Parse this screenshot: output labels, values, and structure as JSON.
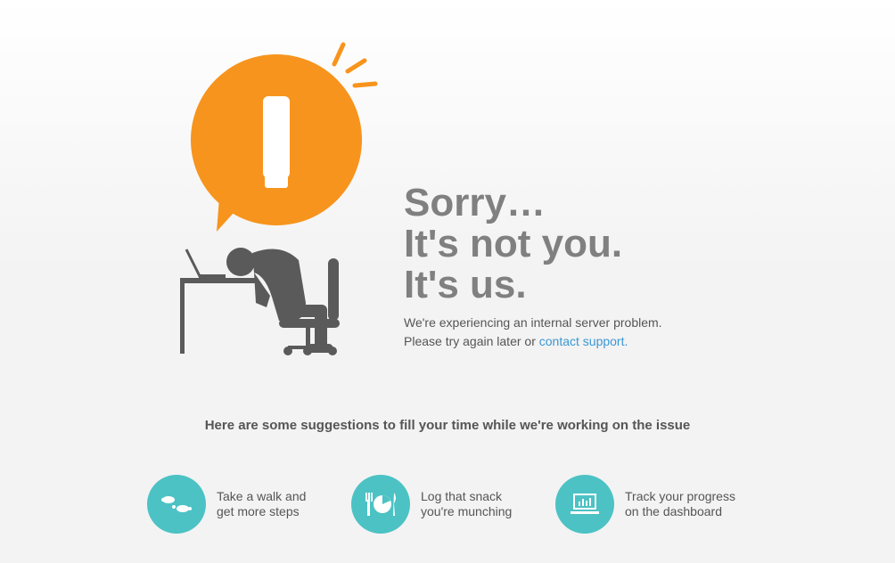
{
  "headline": {
    "line1": "Sorry…",
    "line2": "It's not you.",
    "line3": "It's us."
  },
  "message": {
    "line1": "We're experiencing an internal server problem.",
    "line2_prefix": "Please try again later or ",
    "support_link": "contact support",
    "line2_suffix": "."
  },
  "suggestions_title": "Here are some suggestions to fill your time while we're working on the issue",
  "suggestions": [
    {
      "icon": "footsteps-icon",
      "line1": "Take a walk and",
      "line2": "get more steps"
    },
    {
      "icon": "food-plate-icon",
      "line1": "Log that snack",
      "line2": "you're munching"
    },
    {
      "icon": "dashboard-monitor-icon",
      "line1": "Track your progress",
      "line2": "on the dashboard"
    }
  ],
  "colors": {
    "accent_orange": "#f7941d",
    "accent_teal": "#4cc2c4",
    "link_blue": "#3a97d4",
    "figure_gray": "#5a5a5a",
    "headline_gray": "#808080"
  }
}
